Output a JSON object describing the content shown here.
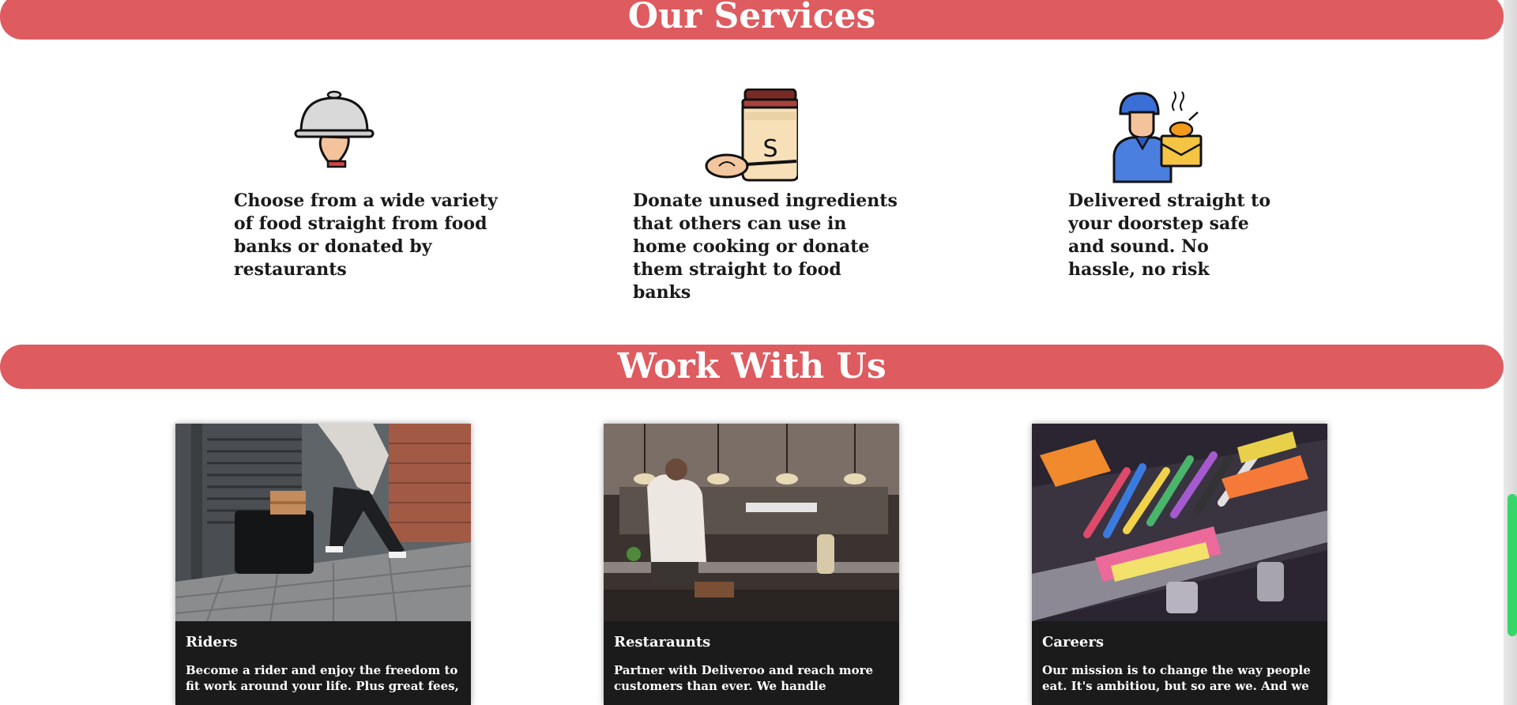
{
  "services": {
    "heading": "Our Services",
    "items": [
      {
        "icon": "serving-cloche-icon",
        "text": "Choose from a wide variety of food straight from food banks or donated by restaurants"
      },
      {
        "icon": "ingredient-jar-icon",
        "text": "Donate unused ingredients that others can use in home cooking or donate them straight to food banks"
      },
      {
        "icon": "delivery-person-icon",
        "text": "Delivered straight to your doorstep safe and sound. No hassle, no risk"
      }
    ]
  },
  "work": {
    "heading": "Work With Us",
    "cards": [
      {
        "title": "Riders",
        "description": "Become a rider and enjoy the freedom to fit work around your life. Plus great fees,"
      },
      {
        "title": "Restaraunts",
        "description": "Partner with Deliveroo and reach more customers than ever. We handle"
      },
      {
        "title": "Careers",
        "description": "Our mission is to change the way people eat. It's ambitiou, but so are we. And we"
      }
    ]
  },
  "colors": {
    "banner": "#de5b5f",
    "card_background": "#1b1b1b",
    "scroll_thumb": "#36d66a"
  }
}
